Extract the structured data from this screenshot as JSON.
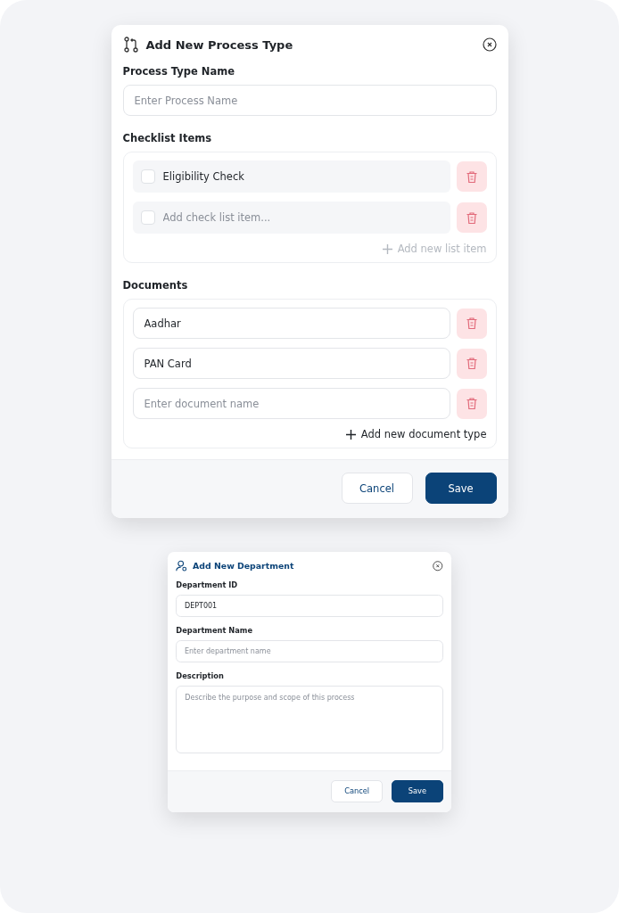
{
  "process_dialog": {
    "title": "Add New Process Type",
    "name_field": {
      "label": "Process Type Name",
      "placeholder": "Enter Process Name"
    },
    "checklist": {
      "label": "Checklist Items",
      "items": [
        {
          "value": "Eligibility Check",
          "checked": false
        },
        {
          "placeholder": "Add check list item...",
          "checked": false
        }
      ],
      "add_action": {
        "label": "Add new list item",
        "disabled": true
      }
    },
    "documents": {
      "label": "Documents",
      "items": [
        {
          "value": "Aadhar"
        },
        {
          "value": "PAN Card"
        },
        {
          "placeholder": "Enter document name"
        }
      ],
      "add_action": {
        "label": "Add new document type",
        "disabled": false
      }
    },
    "buttons": [
      {
        "label": "Cancel",
        "kind": "secondary"
      },
      {
        "label": "Save",
        "kind": "primary"
      }
    ]
  },
  "department_dialog": {
    "title": "Add New Department",
    "fields": [
      {
        "label": "Department ID",
        "value": "DEPT001",
        "kind": "input"
      },
      {
        "label": "Department Name",
        "placeholder": "Enter department name",
        "kind": "input"
      },
      {
        "label": "Description",
        "placeholder": "Describe the purpose and scope of this process",
        "kind": "textarea"
      }
    ],
    "buttons": [
      {
        "label": "Cancel",
        "kind": "secondary"
      },
      {
        "label": "Save",
        "kind": "primary"
      }
    ]
  }
}
